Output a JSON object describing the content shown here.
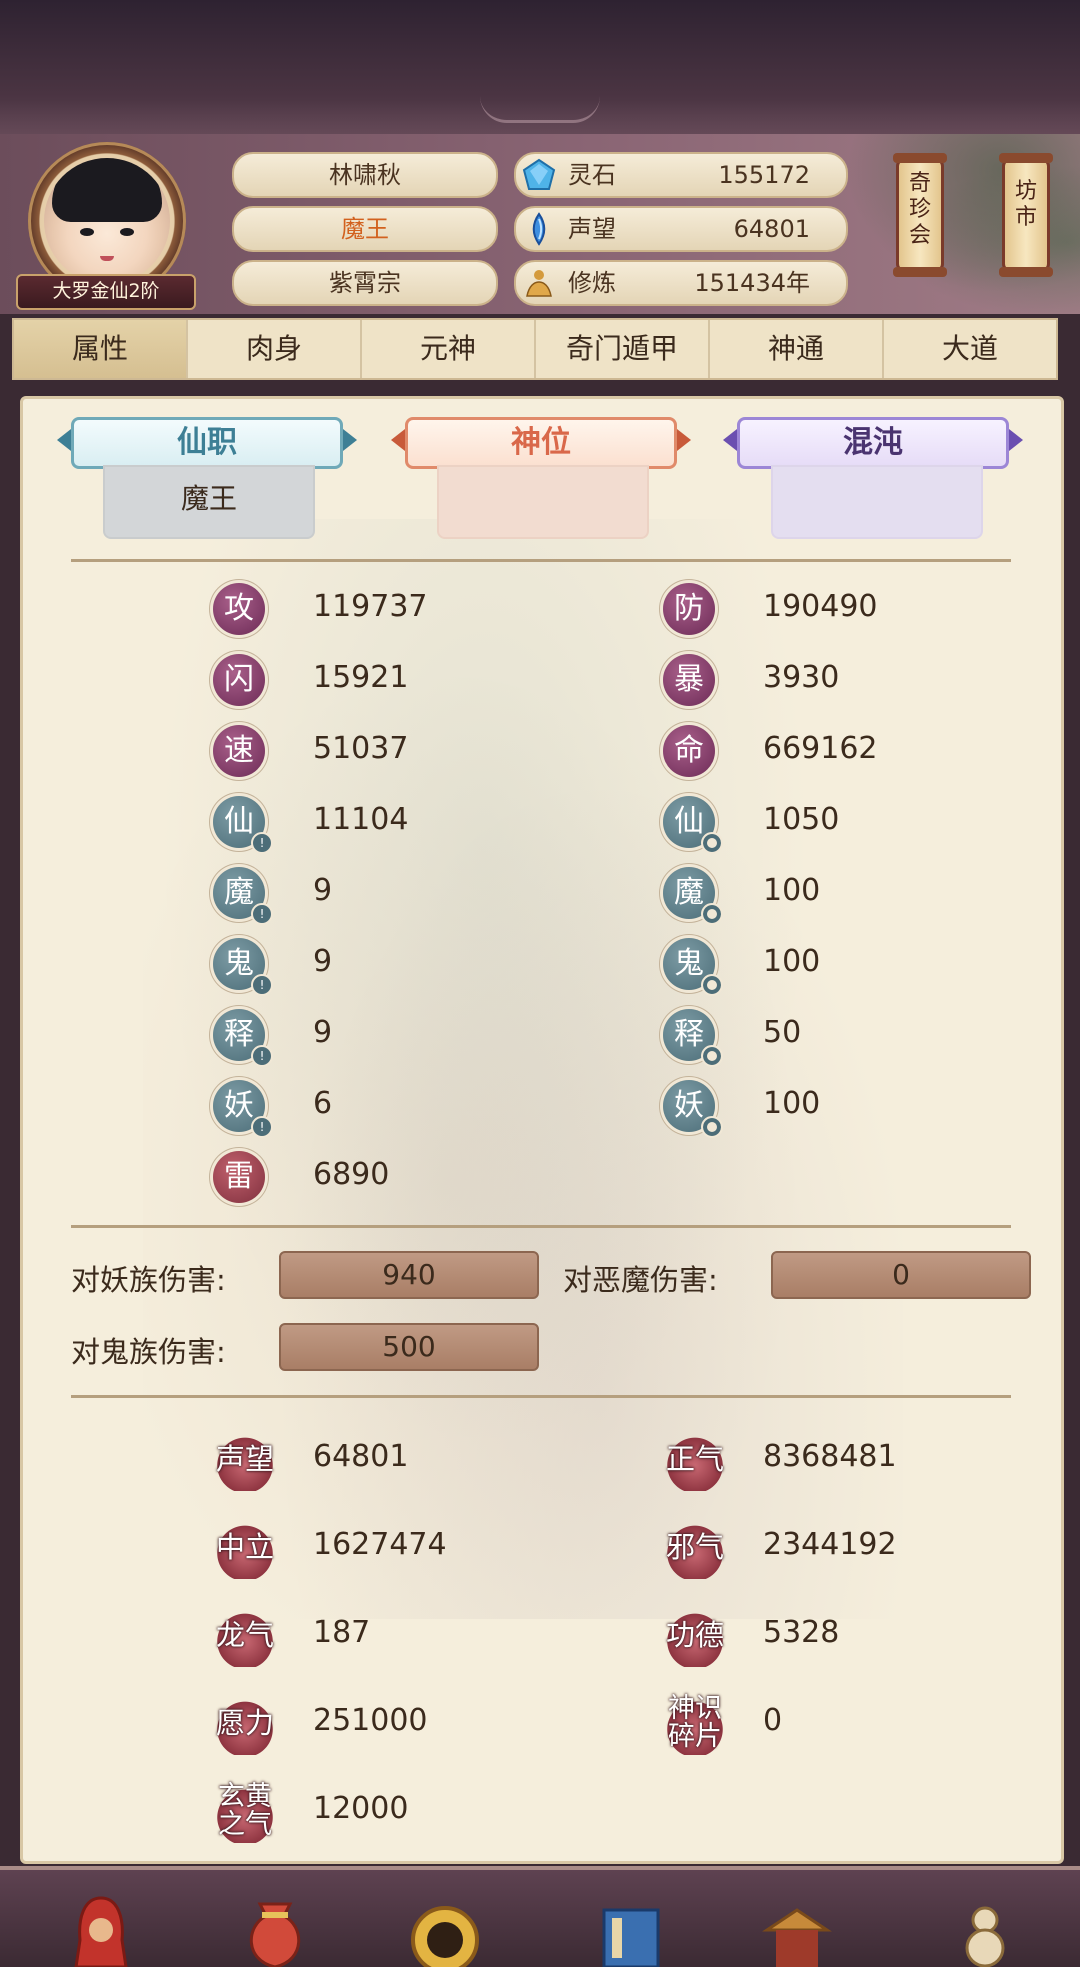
{
  "profile": {
    "name": "林啸秋",
    "title": "魔王",
    "sect": "紫霄宗",
    "rank": "大罗金仙2阶"
  },
  "resources": [
    {
      "label": "灵石",
      "value": "155172",
      "icon": "spirit-stone-icon"
    },
    {
      "label": "声望",
      "value": "64801",
      "icon": "prestige-crystal-icon"
    },
    {
      "label": "修炼",
      "value": "151434年",
      "icon": "meditation-icon"
    }
  ],
  "side_buttons": [
    {
      "label": "奇珍会"
    },
    {
      "label": "坊市"
    }
  ],
  "tabs": [
    "属性",
    "肉身",
    "元神",
    "奇门遁甲",
    "神通",
    "大道"
  ],
  "active_tab": "属性",
  "positions": [
    {
      "title": "仙职",
      "value": "魔王",
      "color": "#3d7f95"
    },
    {
      "title": "神位",
      "value": "",
      "color": "#d9684a"
    },
    {
      "title": "混沌",
      "value": "",
      "color": "#5a3e7a"
    }
  ],
  "stats_left": [
    {
      "label": "攻",
      "value": "119737",
      "style": "purple",
      "badge": ""
    },
    {
      "label": "闪",
      "value": "15921",
      "style": "purple",
      "badge": ""
    },
    {
      "label": "速",
      "value": "51037",
      "style": "purple",
      "badge": ""
    },
    {
      "label": "仙",
      "value": "11104",
      "style": "teal",
      "badge": "!"
    },
    {
      "label": "魔",
      "value": "9",
      "style": "teal",
      "badge": "!"
    },
    {
      "label": "鬼",
      "value": "9",
      "style": "teal",
      "badge": "!"
    },
    {
      "label": "释",
      "value": "9",
      "style": "teal",
      "badge": "!"
    },
    {
      "label": "妖",
      "value": "6",
      "style": "teal",
      "badge": "!"
    },
    {
      "label": "雷",
      "value": "6890",
      "style": "red",
      "badge": ""
    }
  ],
  "stats_right": [
    {
      "label": "防",
      "value": "190490",
      "style": "purple",
      "badge": ""
    },
    {
      "label": "暴",
      "value": "3930",
      "style": "purple",
      "badge": ""
    },
    {
      "label": "命",
      "value": "669162",
      "style": "purple",
      "badge": ""
    },
    {
      "label": "仙",
      "value": "1050",
      "style": "teal",
      "badge": "o"
    },
    {
      "label": "魔",
      "value": "100",
      "style": "teal",
      "badge": "o"
    },
    {
      "label": "鬼",
      "value": "100",
      "style": "teal",
      "badge": "o"
    },
    {
      "label": "释",
      "value": "50",
      "style": "teal",
      "badge": "o"
    },
    {
      "label": "妖",
      "value": "100",
      "style": "teal",
      "badge": "o"
    }
  ],
  "damage": [
    {
      "label": "对妖族伤害:",
      "value": "940"
    },
    {
      "label": "对恶魔伤害:",
      "value": "0"
    },
    {
      "label": "对鬼族伤害:",
      "value": "500"
    }
  ],
  "reputation_left": [
    {
      "label": "声望",
      "value": "64801"
    },
    {
      "label": "中立",
      "value": "1627474"
    },
    {
      "label": "龙气",
      "value": "187"
    },
    {
      "label": "愿力",
      "value": "251000"
    },
    {
      "label": "玄黄之气",
      "value": "12000"
    }
  ],
  "reputation_right": [
    {
      "label": "正气",
      "value": "8368481"
    },
    {
      "label": "邪气",
      "value": "2344192"
    },
    {
      "label": "功德",
      "value": "5328"
    },
    {
      "label": "神识碎片",
      "value": "0"
    }
  ],
  "bottom_nav_icons": [
    "hooded-figure-icon",
    "treasure-bag-icon",
    "gold-coin-icon",
    "book-icon",
    "pagoda-icon",
    "gourd-icon"
  ]
}
